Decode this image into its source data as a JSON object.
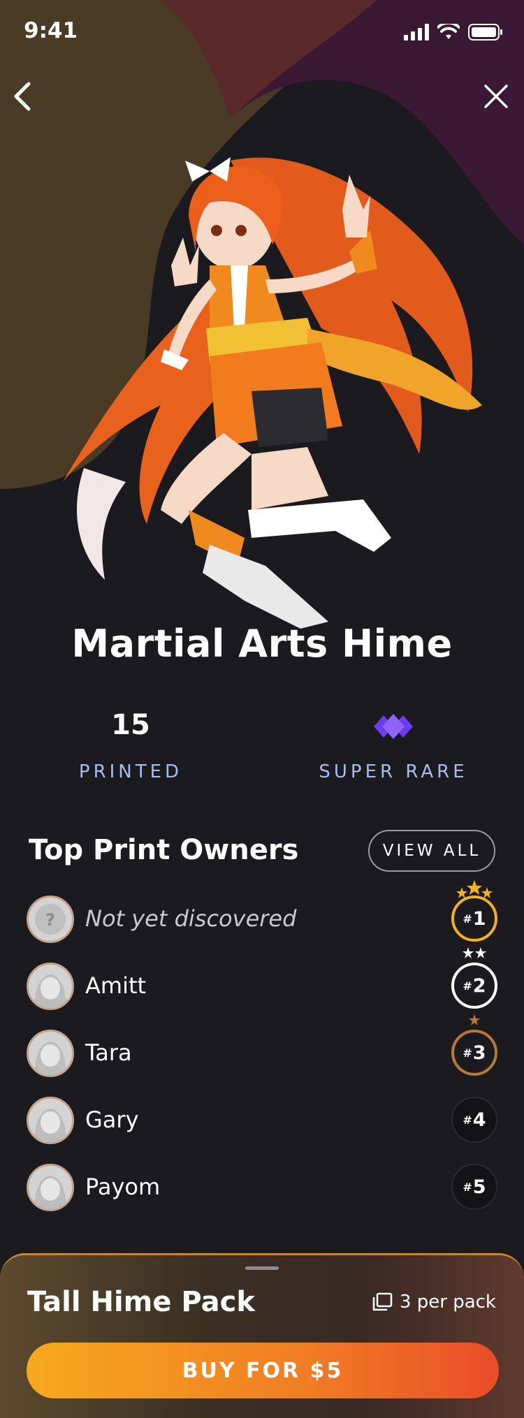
{
  "status_bar": {
    "time": "9:41"
  },
  "card": {
    "name": "Martial Arts Hime",
    "printed_value": "15",
    "printed_label": "PRINTED",
    "rarity_label": "SUPER RARE",
    "rarity_color": "#7b4bff"
  },
  "owners": {
    "title": "Top Print Owners",
    "view_all_label": "VIEW ALL",
    "items": [
      {
        "name": "Not yet discovered",
        "rank": "1"
      },
      {
        "name": "Amitt",
        "rank": "2"
      },
      {
        "name": "Tara",
        "rank": "3"
      },
      {
        "name": "Gary",
        "rank": "4"
      },
      {
        "name": "Payom",
        "rank": "5"
      }
    ],
    "rank_prefix": "#"
  },
  "pack": {
    "title": "Tall Hime Pack",
    "per_pack": "3 per pack",
    "buy_label": "BUY FOR $5"
  },
  "colors": {
    "gold": "#f0b31e",
    "silver": "#ffffff",
    "bronze": "#b77a35",
    "accent_blue": "#a9bdf1"
  }
}
